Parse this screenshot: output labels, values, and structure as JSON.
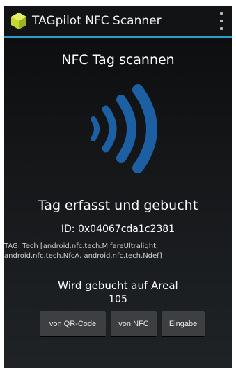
{
  "app": {
    "title": "TAGpilot NFC Scanner"
  },
  "main": {
    "heading": "NFC Tag scannen",
    "status": "Tag erfasst und gebucht",
    "tag_id": "ID: 0x04067cda1c2381",
    "tech_info": "TAG: Tech [android.nfc.tech.MifareUltralight, android.nfc.tech.NfcA, android.nfc.tech.Ndef]",
    "areal_label": "Wird gebucht auf Areal",
    "areal_value": "105"
  },
  "buttons": {
    "qr": "von QR-Code",
    "nfc": "von NFC",
    "input": "Eingabe"
  },
  "colors": {
    "accent": "#2e9ec8",
    "nfc_icon": "#1d5fa3",
    "app_icon": "#c5d830"
  }
}
